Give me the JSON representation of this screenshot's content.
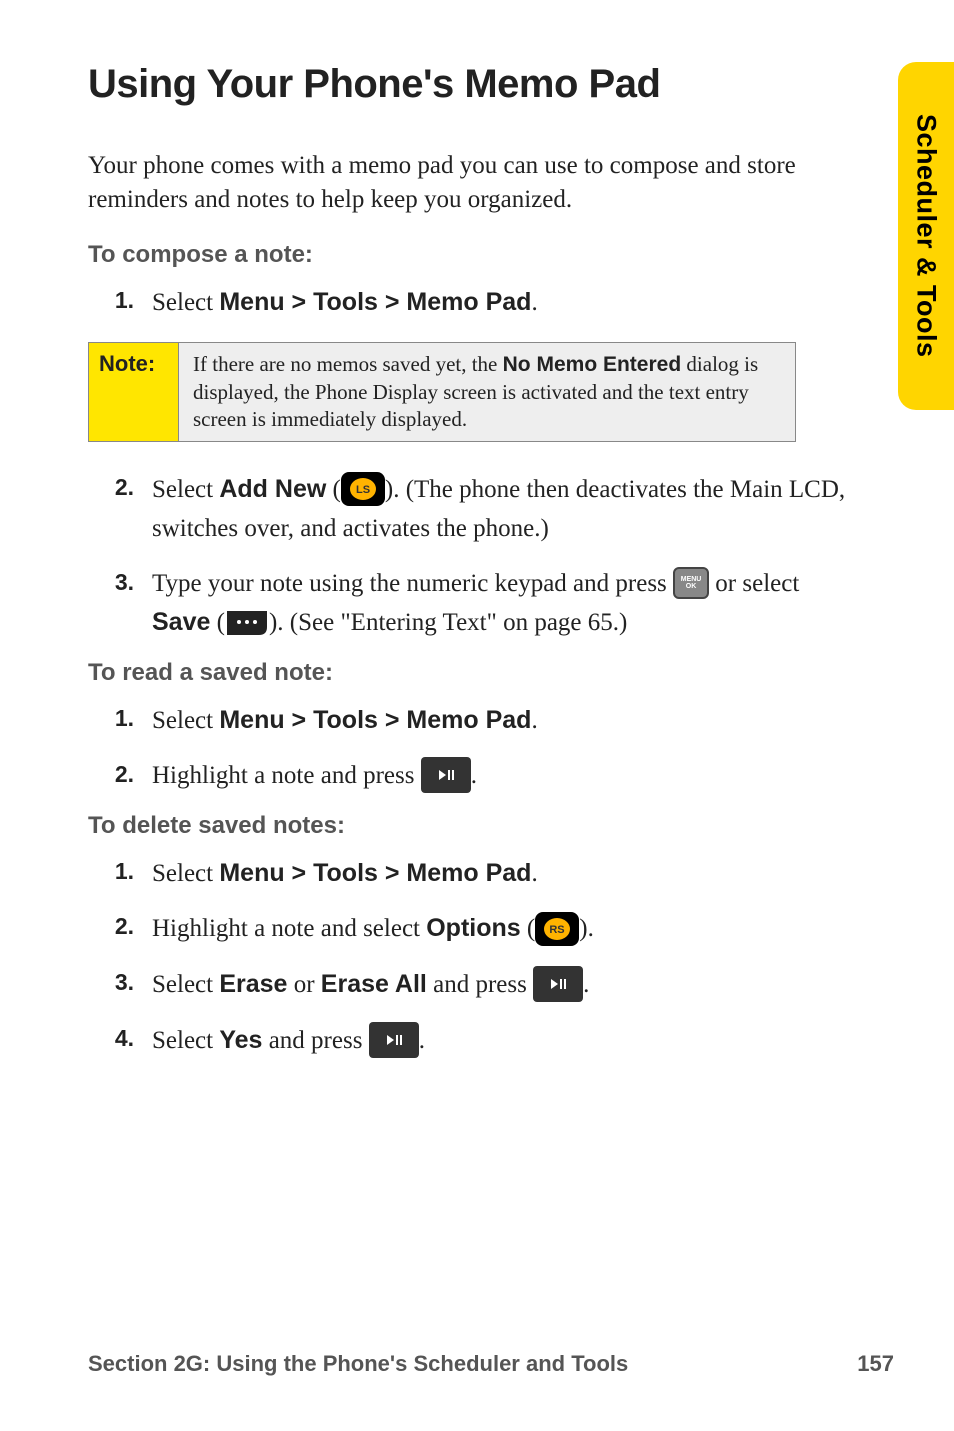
{
  "side_tab": "Scheduler & Tools",
  "title": "Using Your Phone's Memo Pad",
  "intro": "Your phone comes with a memo pad you can use to compose and store reminders and notes to help keep you organized.",
  "compose": {
    "heading": "To compose a note:",
    "step1_prefix": "Select ",
    "step1_bold": "Menu > Tools > Memo Pad",
    "step1_suffix": ".",
    "note_label": "Note:",
    "note_text_a": "If there are no memos saved yet, the ",
    "note_bold": "No Memo Entered",
    "note_text_b": " dialog is displayed, the Phone Display screen is activated and the text entry screen is immediately displayed.",
    "step2_a": "Select ",
    "step2_bold1": "Add New",
    "step2_b": " (",
    "step2_c": "). (The phone then deactivates the Main LCD, switches over, and activates the phone.)",
    "step3_a": "Type your note using the numeric keypad and press ",
    "step3_b": " or select ",
    "step3_bold": "Save",
    "step3_c": " (",
    "step3_d": "). (See \"Entering Text\" on page 65.)"
  },
  "read": {
    "heading": "To read a saved note:",
    "step1_prefix": "Select ",
    "step1_bold": "Menu > Tools > Memo Pad",
    "step1_suffix": ".",
    "step2_a": "Highlight a note and press ",
    "step2_b": "."
  },
  "delete": {
    "heading": "To delete saved notes:",
    "step1_prefix": "Select ",
    "step1_bold": "Menu > Tools > Memo Pad",
    "step1_suffix": ".",
    "step2_a": "Highlight a note and select ",
    "step2_bold": "Options",
    "step2_b": " (",
    "step2_c": ").",
    "step3_a": "Select ",
    "step3_bold1": "Erase",
    "step3_mid": " or ",
    "step3_bold2": "Erase All",
    "step3_b": " and press ",
    "step3_c": ".",
    "step4_a": "Select ",
    "step4_bold": "Yes",
    "step4_b": " and press ",
    "step4_c": "."
  },
  "footer_left": "Section 2G: Using the Phone's Scheduler and Tools",
  "footer_right": "157",
  "nums": {
    "n1": "1.",
    "n2": "2.",
    "n3": "3.",
    "n4": "4."
  },
  "keys": {
    "menu_top": "MENU",
    "menu_bot": "OK"
  }
}
